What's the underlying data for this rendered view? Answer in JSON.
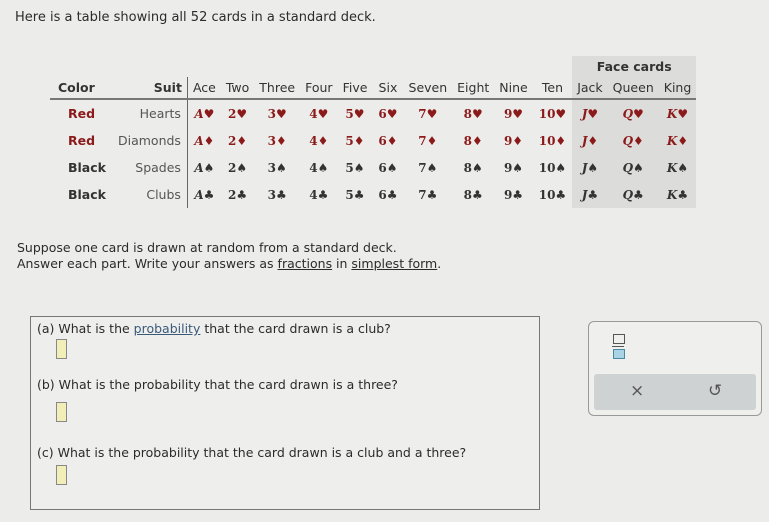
{
  "intro": "Here is a table showing all 52 cards in a standard deck.",
  "table": {
    "face_cards_label": "Face cards",
    "color_header": "Color",
    "suit_header": "Suit",
    "rank_headers": [
      "Ace",
      "Two",
      "Three",
      "Four",
      "Five",
      "Six",
      "Seven",
      "Eight",
      "Nine",
      "Ten",
      "Jack",
      "Queen",
      "King"
    ],
    "rows": [
      {
        "color": "Red",
        "suit": "Hearts",
        "tone": "red",
        "cards": [
          "A♥",
          "2♥",
          "3♥",
          "4♥",
          "5♥",
          "6♥",
          "7♥",
          "8♥",
          "9♥",
          "10♥",
          "J♥",
          "Q♥",
          "K♥"
        ]
      },
      {
        "color": "Red",
        "suit": "Diamonds",
        "tone": "red",
        "cards": [
          "A♦",
          "2♦",
          "3♦",
          "4♦",
          "5♦",
          "6♦",
          "7♦",
          "8♦",
          "9♦",
          "10♦",
          "J♦",
          "Q♦",
          "K♦"
        ]
      },
      {
        "color": "Black",
        "suit": "Spades",
        "tone": "black",
        "cards": [
          "A♠",
          "2♠",
          "3♠",
          "4♠",
          "5♠",
          "6♠",
          "7♠",
          "8♠",
          "9♠",
          "10♠",
          "J♠",
          "Q♠",
          "K♠"
        ]
      },
      {
        "color": "Black",
        "suit": "Clubs",
        "tone": "black",
        "cards": [
          "A♣",
          "2♣",
          "3♣",
          "4♣",
          "5♣",
          "6♣",
          "7♣",
          "8♣",
          "9♣",
          "10♣",
          "J♣",
          "Q♣",
          "K♣"
        ]
      }
    ],
    "colors": {
      "red": "#8b1a1a",
      "black": "#333333",
      "face_bg": "#dcdcda"
    }
  },
  "instructions": {
    "line1": "Suppose one card is drawn at random from a standard deck.",
    "line2_pre": "Answer each part. Write your answers as ",
    "link1": "fractions",
    "line2_mid": " in ",
    "link2": "simplest form",
    "line2_post": "."
  },
  "questions": {
    "a_pre": "(a) What is the ",
    "a_link": "probability",
    "a_post": " that the card drawn is a club?",
    "a_value": "",
    "b": "(b) What is the probability that the card drawn is a three?",
    "b_value": "",
    "c": "(c) What is the probability that the card drawn is a club and a three?",
    "c_value": ""
  },
  "toolbox": {
    "fraction_icon": "fraction-icon",
    "clear_label": "×",
    "undo_label": "↺"
  }
}
